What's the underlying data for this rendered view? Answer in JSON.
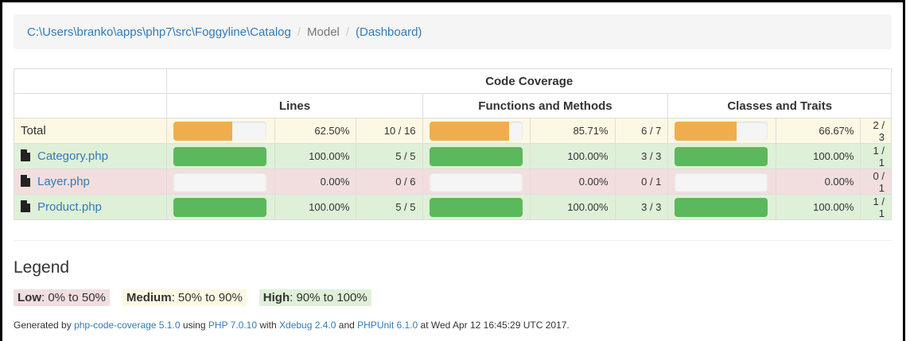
{
  "breadcrumb": {
    "path": "C:\\Users\\branko\\apps\\php7\\src\\Foggyline\\Catalog",
    "sep1": "/",
    "current": "Model",
    "sep2": "/",
    "dashboard": "(Dashboard)"
  },
  "table": {
    "group_header": "Code Coverage",
    "col_lines": "Lines",
    "col_functions": "Functions and Methods",
    "col_classes": "Classes and Traits",
    "rows": [
      {
        "name": "Total",
        "status": "warning",
        "lines": {
          "pct": "62.50%",
          "count": "10 / 16",
          "fill": 0.625,
          "color": "#f0ad4e"
        },
        "functions": {
          "pct": "85.71%",
          "count": "6 / 7",
          "fill": 0.8571,
          "color": "#f0ad4e"
        },
        "classes": {
          "pct": "66.67%",
          "count": "2 / 3",
          "fill": 0.6667,
          "color": "#f0ad4e"
        }
      },
      {
        "name": "Category.php",
        "status": "success",
        "lines": {
          "pct": "100.00%",
          "count": "5 / 5",
          "fill": 1.0,
          "color": "#5cb85c"
        },
        "functions": {
          "pct": "100.00%",
          "count": "3 / 3",
          "fill": 1.0,
          "color": "#5cb85c"
        },
        "classes": {
          "pct": "100.00%",
          "count": "1 / 1",
          "fill": 1.0,
          "color": "#5cb85c"
        }
      },
      {
        "name": "Layer.php",
        "status": "danger",
        "lines": {
          "pct": "0.00%",
          "count": "0 / 6",
          "fill": 0.0,
          "color": "#d9534f"
        },
        "functions": {
          "pct": "0.00%",
          "count": "0 / 1",
          "fill": 0.0,
          "color": "#d9534f"
        },
        "classes": {
          "pct": "0.00%",
          "count": "0 / 1",
          "fill": 0.0,
          "color": "#d9534f"
        }
      },
      {
        "name": "Product.php",
        "status": "success",
        "lines": {
          "pct": "100.00%",
          "count": "5 / 5",
          "fill": 1.0,
          "color": "#5cb85c"
        },
        "functions": {
          "pct": "100.00%",
          "count": "3 / 3",
          "fill": 1.0,
          "color": "#5cb85c"
        },
        "classes": {
          "pct": "100.00%",
          "count": "1 / 1",
          "fill": 1.0,
          "color": "#5cb85c"
        }
      }
    ]
  },
  "legend": {
    "title": "Legend",
    "low_label": "Low",
    "low_range": ": 0% to 50%",
    "medium_label": "Medium",
    "medium_range": ": 50% to 90%",
    "high_label": "High",
    "high_range": ": 90% to 100%"
  },
  "footer": {
    "t1": "Generated by ",
    "link1": "php-code-coverage 5.1.0",
    "t2": " using ",
    "link2": "PHP 7.0.10",
    "t3": " with ",
    "link3": "Xdebug 2.4.0",
    "t4": " and ",
    "link4": "PHPUnit 6.1.0",
    "t5": " at Wed Apr 12 16:45:29 UTC 2017."
  },
  "colors": {
    "link": "#337ab7",
    "warning_bg": "#fcf8e3",
    "danger_bg": "#f2dede",
    "success_bg": "#dff0d8"
  }
}
